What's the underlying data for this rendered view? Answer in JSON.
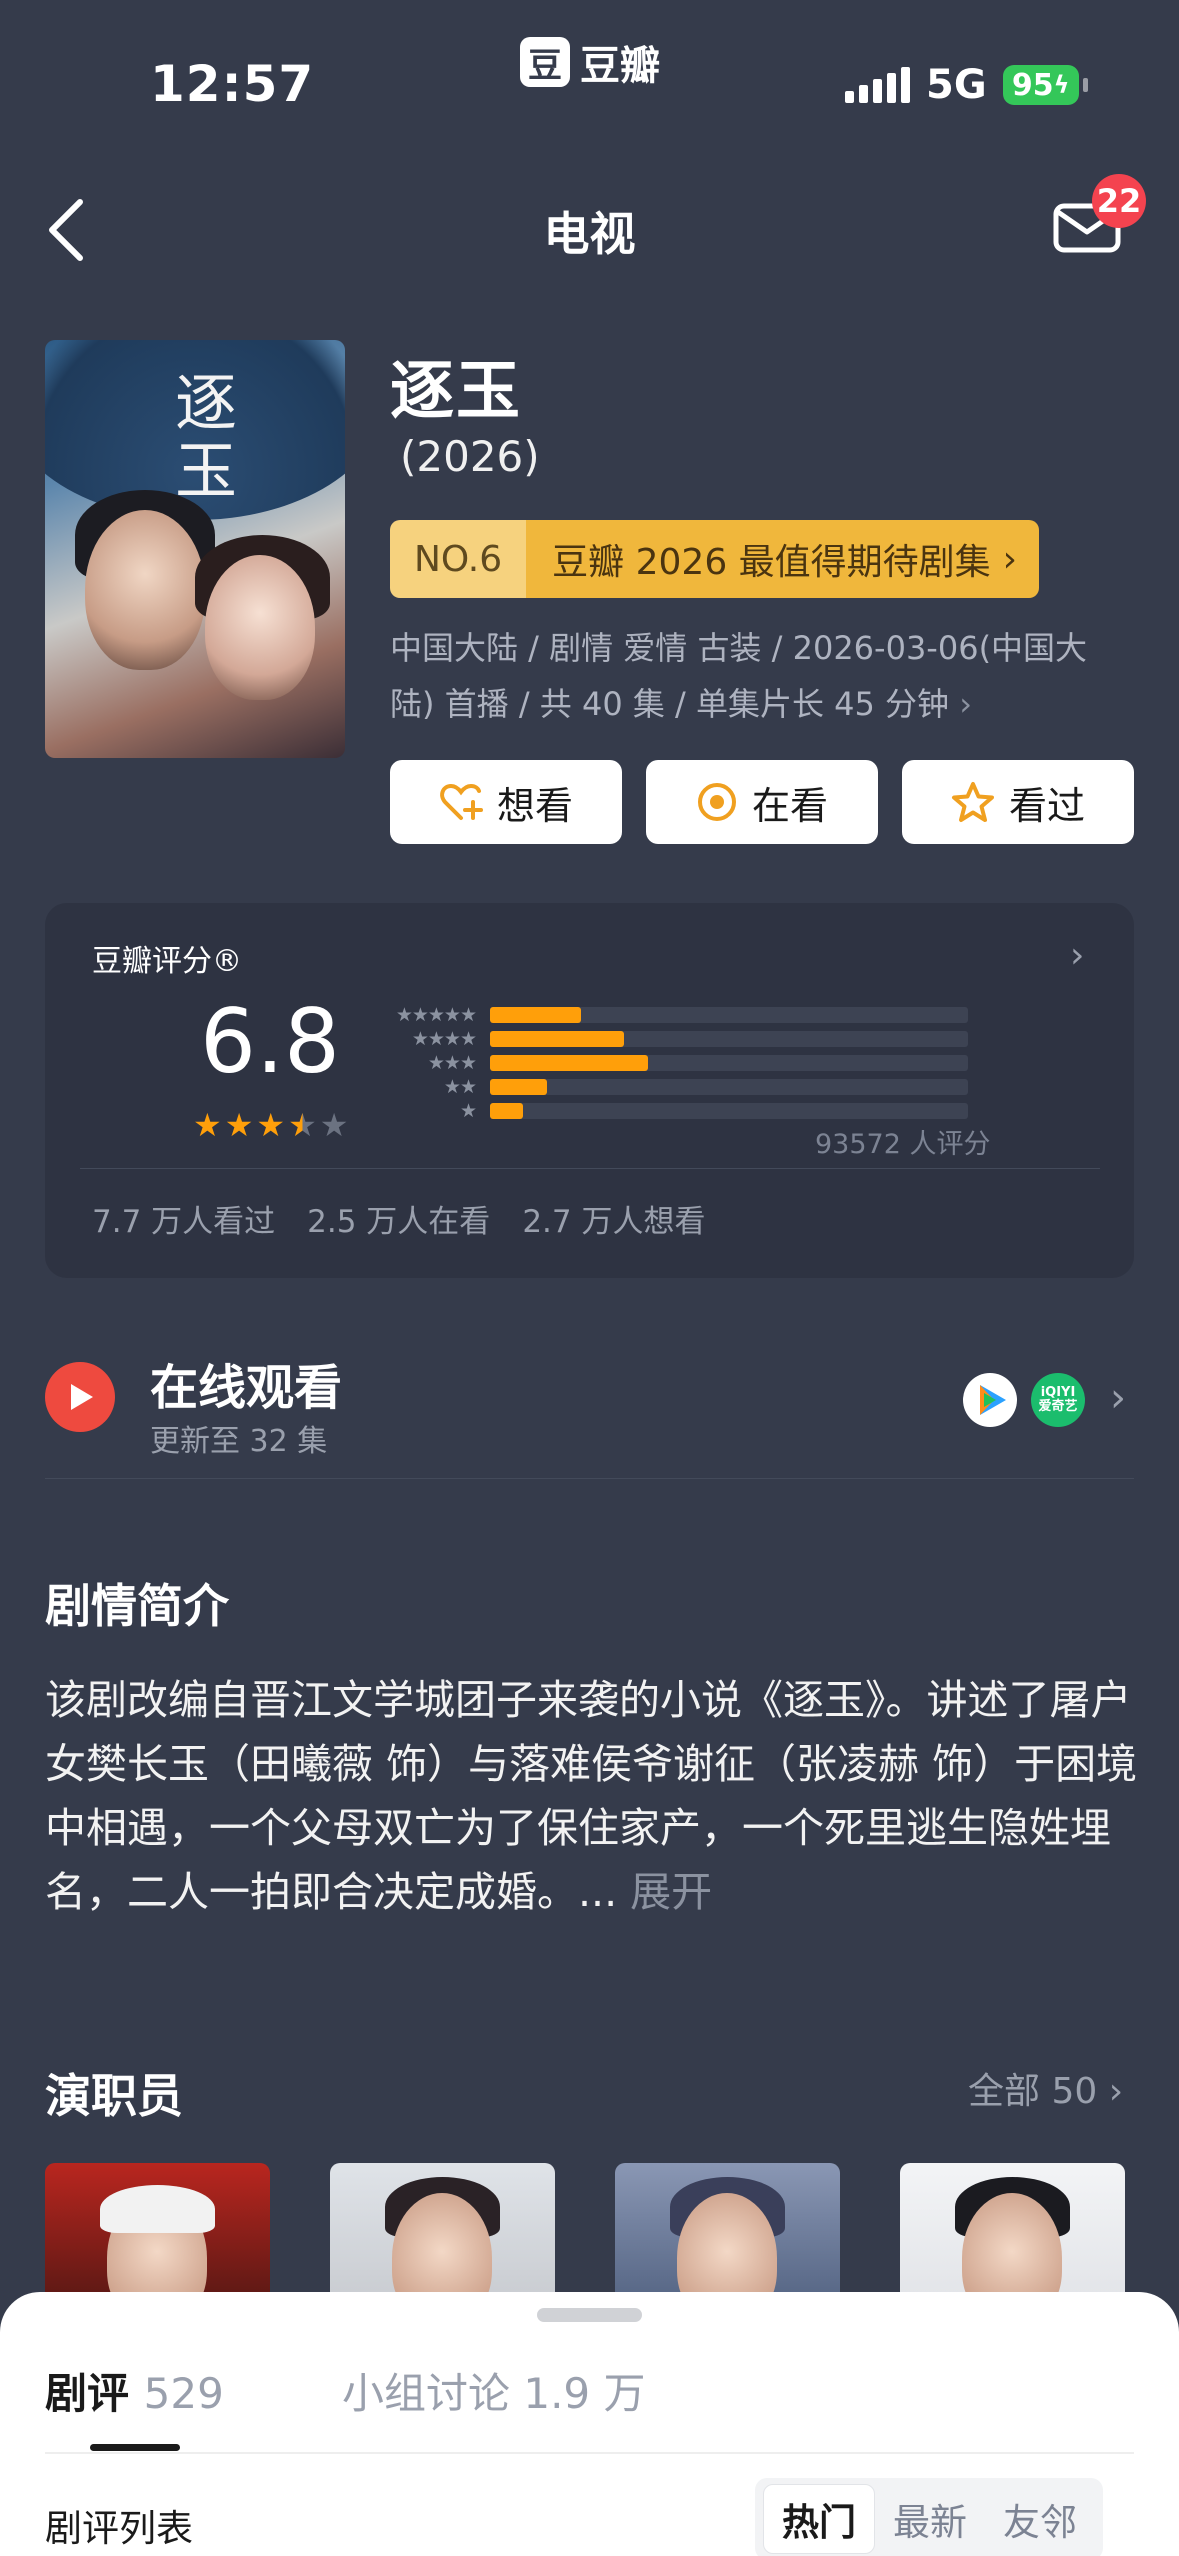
{
  "status_bar": {
    "time": "12:57",
    "brand_logo": "豆",
    "brand_text": "豆瓣",
    "network": "5G",
    "battery": "95"
  },
  "nav": {
    "title": "电视",
    "message_badge": "22"
  },
  "show": {
    "title": "逐玉",
    "year": "(2026)",
    "poster_title": "逐玉",
    "rank_no": "NO.6",
    "rank_text": "豆瓣 2026 最值得期待剧集",
    "meta": "中国大陆 / 剧情 爱情 古装 / 2026-03-06(中国大陆) 首播 / 共 40 集 / 单集片长 45 分钟",
    "actions": [
      {
        "label": "想看",
        "icon": "heart-plus-icon"
      },
      {
        "label": "在看",
        "icon": "circle-dot-icon"
      },
      {
        "label": "看过",
        "icon": "star-outline-icon"
      }
    ]
  },
  "rating": {
    "label": "豆瓣评分®",
    "score": "6.8",
    "stars_value": 3.5,
    "distribution": [
      {
        "stars": "★★★★★",
        "share": 0.19
      },
      {
        "stars": "★★★★",
        "share": 0.28
      },
      {
        "stars": "★★★",
        "share": 0.33
      },
      {
        "stars": "★★",
        "share": 0.12
      },
      {
        "stars": "★",
        "share": 0.07
      }
    ],
    "count": "93572 人评分",
    "stats": [
      "7.7 万人看过",
      "2.5 万人在看",
      "2.7 万人想看"
    ]
  },
  "watch": {
    "title": "在线观看",
    "subtitle": "更新至 32 集",
    "platform2": "iQIYI 爱奇艺"
  },
  "synopsis": {
    "heading": "剧情简介",
    "text": "该剧改编自晋江文学城团子来袭的小说《逐玉》。讲述了屠户女樊长玉（田曦薇 饰）与落难侯爷谢征（张凌赫 饰）于困境中相遇，一个父母双亡为了保住家产，一个死里逃生隐姓埋名，二人一拍即合决定成婚。...",
    "more": "展开"
  },
  "cast": {
    "heading": "演职员",
    "all_label": "全部 50"
  },
  "sheet": {
    "tab_review_label": "剧评",
    "tab_review_count": "529",
    "tab_group": "小组讨论 1.9 万",
    "list_label": "剧评列表",
    "segments": [
      "热门",
      "最新",
      "友邻"
    ]
  },
  "colors": {
    "background": "#353b4b",
    "accent_orange": "#ff9f0a",
    "badge_red": "#f4434f",
    "rank_gold": "#f0b73c"
  }
}
